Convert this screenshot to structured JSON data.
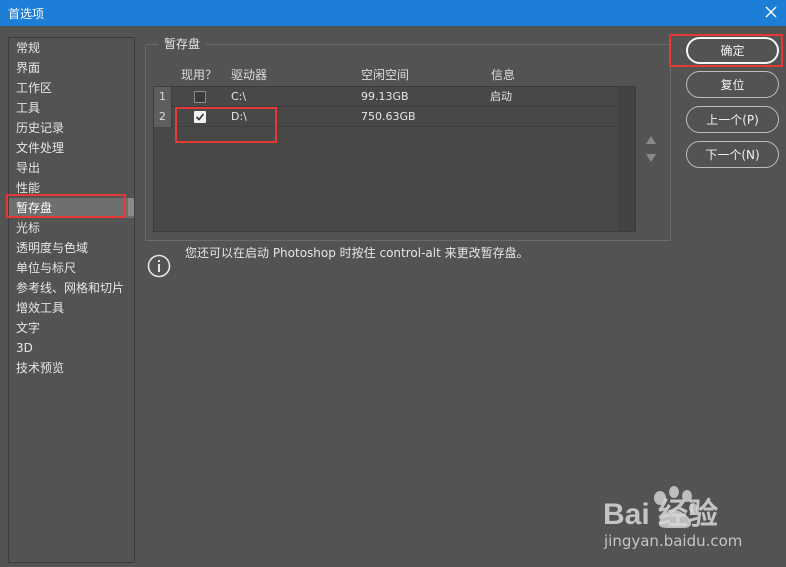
{
  "window": {
    "title": "首选项"
  },
  "sidebar": {
    "items": [
      {
        "label": "常规"
      },
      {
        "label": "界面"
      },
      {
        "label": "工作区"
      },
      {
        "label": "工具"
      },
      {
        "label": "历史记录"
      },
      {
        "label": "文件处理"
      },
      {
        "label": "导出"
      },
      {
        "label": "性能"
      },
      {
        "label": "暂存盘"
      },
      {
        "label": "光标"
      },
      {
        "label": "透明度与色域"
      },
      {
        "label": "单位与标尺"
      },
      {
        "label": "参考线、网格和切片"
      },
      {
        "label": "增效工具"
      },
      {
        "label": "文字"
      },
      {
        "label": "3D"
      },
      {
        "label": "技术预览"
      }
    ],
    "active_index": 8
  },
  "scratch": {
    "group_label": "暂存盘",
    "columns": {
      "active": "现用？",
      "drive": "驱动器",
      "free": "空闲空间",
      "info": "信息"
    },
    "rows": [
      {
        "num": "1",
        "checked": false,
        "drive": "C:\\",
        "free": "99.13GB",
        "info": "启动"
      },
      {
        "num": "2",
        "checked": true,
        "drive": "D:\\",
        "free": "750.63GB",
        "info": ""
      }
    ]
  },
  "buttons": {
    "ok": "确定",
    "reset": "复位",
    "prev": "上一个(P)",
    "next": "下一个(N)"
  },
  "info": {
    "text": "您还可以在启动 Photoshop 时按住 control-alt 来更改暂存盘。"
  },
  "watermark": {
    "brand": "Bai 经验",
    "url": "jingyan.baidu.com"
  },
  "colors": {
    "titlebar": "#1c7ed6",
    "highlight": "#e53935",
    "background": "#535353"
  }
}
